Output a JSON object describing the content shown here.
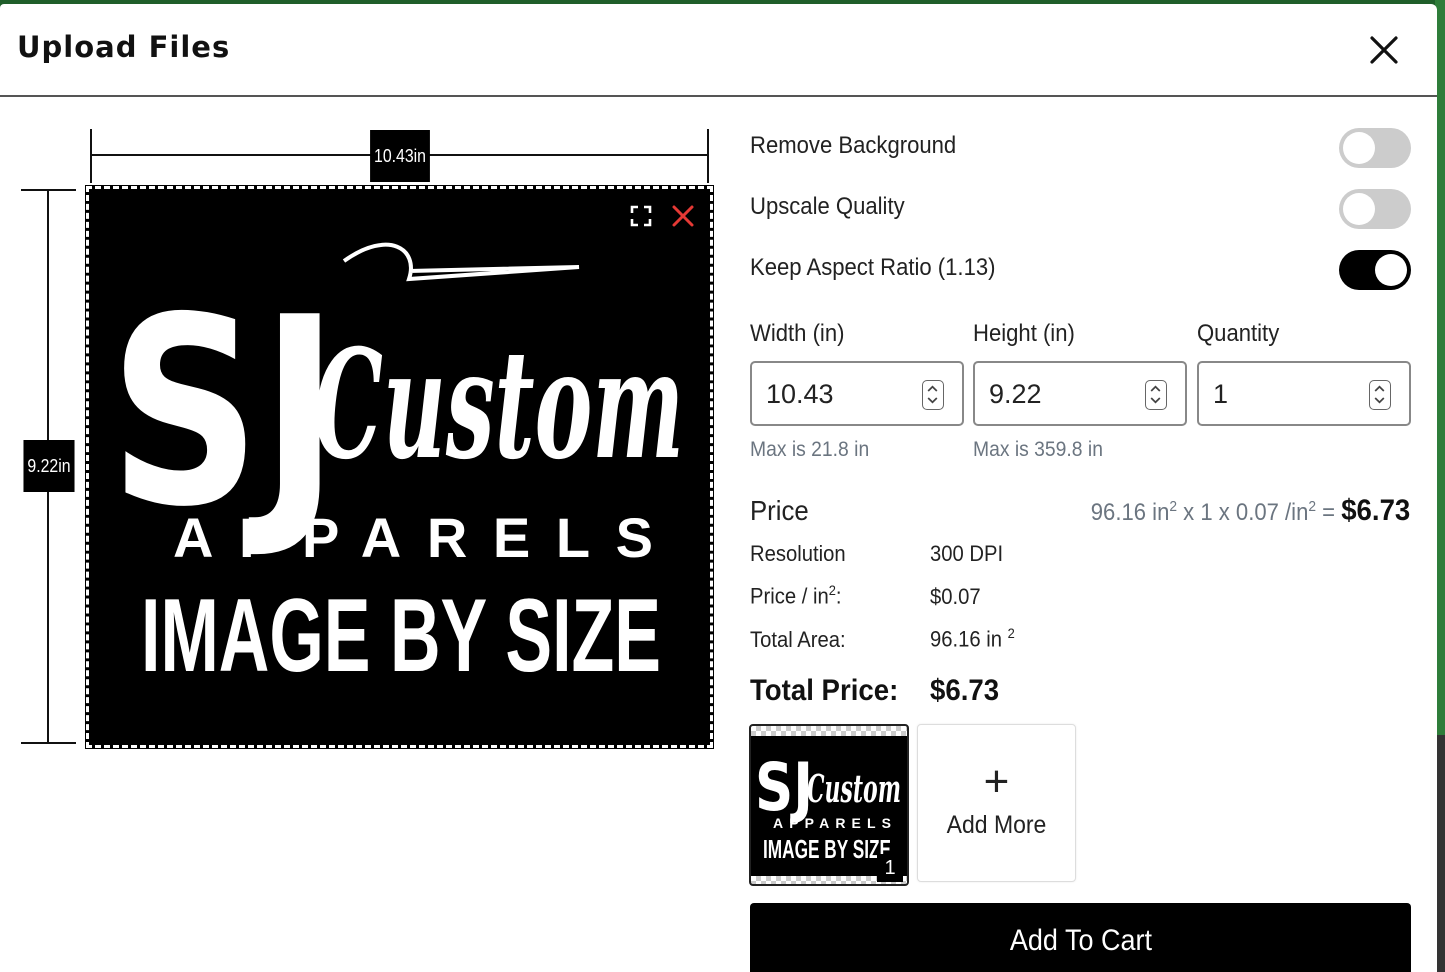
{
  "modal": {
    "title": "Upload Files"
  },
  "preview": {
    "width_label": "10.43in",
    "height_label": "9.22in",
    "artwork_lines": [
      "SJ",
      "Custom",
      "APPARELS",
      "IMAGE BY SIZE"
    ],
    "canvas_background": "#000000",
    "remove_icon_color": "#e53935"
  },
  "options": {
    "remove_background": {
      "label": "Remove Background",
      "on": false
    },
    "upscale_quality": {
      "label": "Upscale Quality",
      "on": false
    },
    "keep_aspect_ratio": {
      "label": "Keep Aspect Ratio (1.13)",
      "on": true
    }
  },
  "fields": {
    "width": {
      "label": "Width (in)",
      "value": "10.43",
      "max": "Max is 21.8 in"
    },
    "height": {
      "label": "Height (in)",
      "value": "9.22",
      "max": "Max is 359.8 in"
    },
    "quantity": {
      "label": "Quantity",
      "value": "1"
    }
  },
  "price": {
    "heading": "Price",
    "formula_area": "96.16 in",
    "formula_mid": " x 1 x 0.07 /in",
    "formula_eq": " = ",
    "formula_total": "$6.73",
    "superscript": "2",
    "resolution_label": "Resolution",
    "resolution_value": "300 DPI",
    "price_per_label": "Price / in",
    "price_per_suffix": ":",
    "price_per_value": "$0.07",
    "total_area_label": "Total Area:",
    "total_area_value": "96.16 in ",
    "total_label": "Total Price:",
    "total_value": "$6.73"
  },
  "thumbnails": [
    {
      "count": "1"
    }
  ],
  "add_more": {
    "icon": "+",
    "label": "Add More"
  },
  "cart_button": "Add To Cart"
}
